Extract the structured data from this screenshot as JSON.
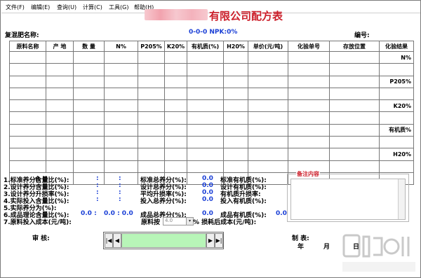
{
  "menu": [
    "文件(F)",
    "编辑(E)",
    "查询(U)",
    "计算(C)",
    "工具(G)",
    "帮助(H)"
  ],
  "title": {
    "suffix": "有限公司配方表"
  },
  "header": {
    "name_label": "复混肥名称:",
    "npk": "0-0-0 NPK:0%",
    "number_label": "编号:"
  },
  "columns": [
    "原料名称",
    "产 地",
    "数 量",
    "N%",
    "P205%",
    "K20%",
    "有机质(%)",
    "H20%",
    "单价(元/吨)",
    "化验单号",
    "存放位置",
    "化验结果"
  ],
  "test_results": [
    "N%",
    "P205%",
    "K20%",
    "有机质%",
    "H20%"
  ],
  "total_label": "合 计",
  "left_stats": [
    {
      "label": "1.标准养分含量比(%):",
      "v1": ":",
      "v2": ":"
    },
    {
      "label": "2.设计养分含量比(%):",
      "v1": ":",
      "v2": ":"
    },
    {
      "label": "3.设计养分升损率(%):",
      "v1": ":",
      "v2": ":"
    },
    {
      "label": "4.实际投入含量比(%):",
      "v1": ":",
      "v2": ":"
    },
    {
      "label": "5.实际养分为(%):",
      "v1": "",
      "v2": ""
    },
    {
      "label": "6.成品理论含量比(%):",
      "v1": "0.0 :",
      "v2": "0.0 : 0.0"
    },
    {
      "label": "7.原料投入成本(元/吨):",
      "v1": "",
      "v2": ""
    }
  ],
  "mid_stats": [
    {
      "label": "标准总养分(%):",
      "value": "0.0"
    },
    {
      "label": "设计总养分(%):",
      "value": "0.0"
    },
    {
      "label": "平均升损率(%):",
      "value": "0.0"
    },
    {
      "label": "投入总养分(%):",
      "value": "0.0"
    },
    {
      "label": "成品总养分(%):",
      "value": "0.0"
    }
  ],
  "right_stats": [
    "标准有机质(%):",
    "设计有机质(%):",
    "有机质升损率:",
    "投入有机质(%):",
    "成品有机质(%):"
  ],
  "right_value": "0.0",
  "raw_material": {
    "label": "原料按",
    "value": "4.0",
    "suffix": "% 损耗后成本(元/吨):"
  },
  "memo_label": "备注内容",
  "audit": {
    "label": "审 核:"
  },
  "maker": {
    "label": "制 表:",
    "year": "年",
    "month": "月",
    "day": "日"
  },
  "nav": {
    "first": "|◀",
    "prev": "◀",
    "next": "▶",
    "last": "▶|"
  },
  "colors": {
    "red": "#cc1f2a",
    "blue": "#1a3fd6",
    "nav_green": "#b8f5b8"
  }
}
